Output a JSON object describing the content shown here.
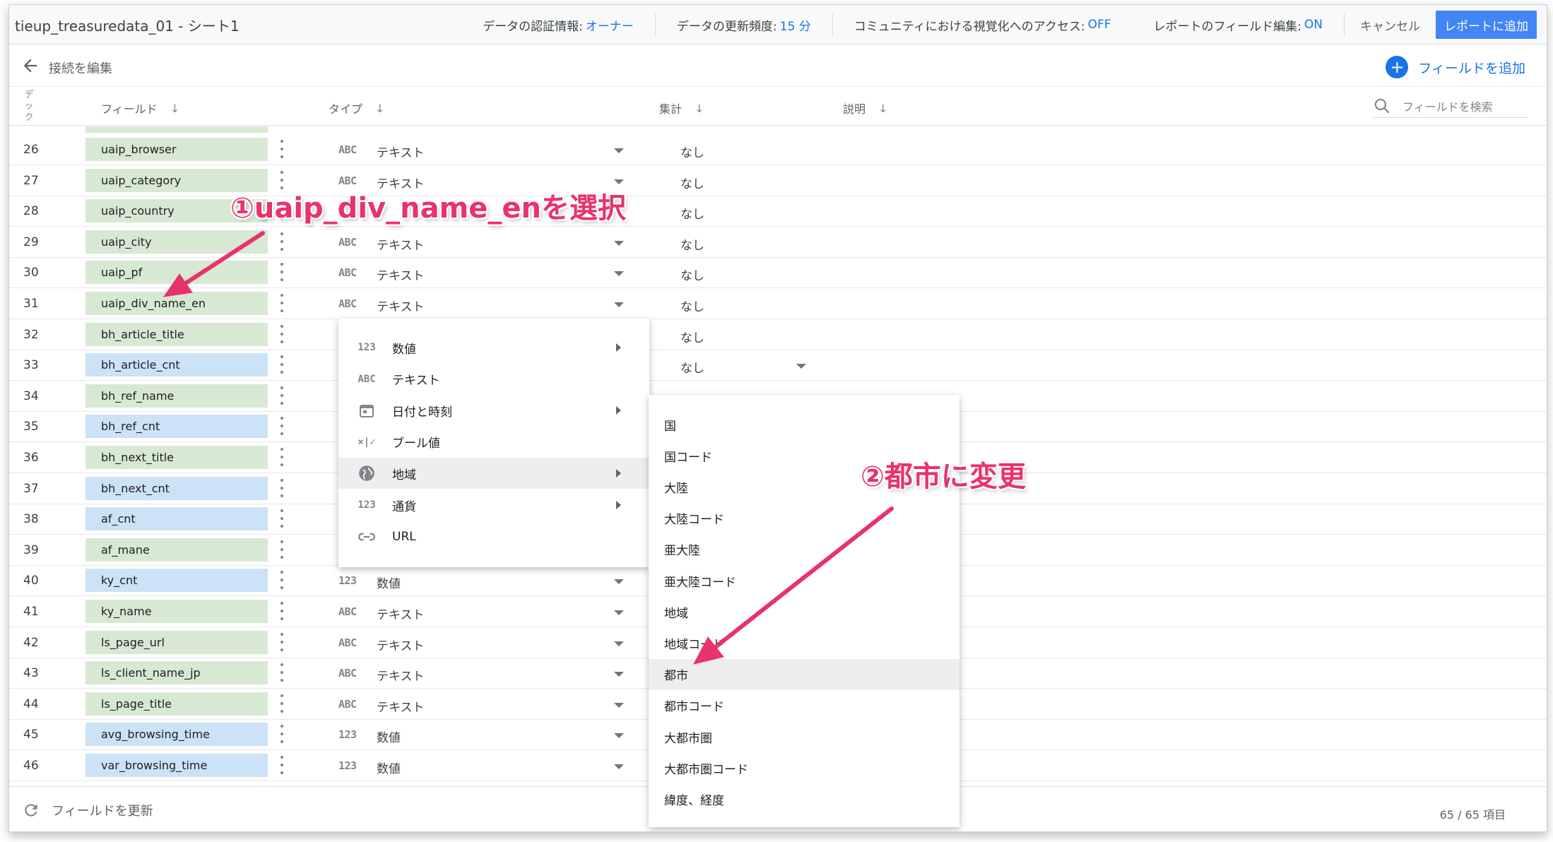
{
  "topbar": {
    "title": "tieup_treasuredata_01 - シート1",
    "credentials_label": "データの認証情報:",
    "credentials_value": "オーナー",
    "freshness_label": "データの更新頻度:",
    "freshness_value": "15 分",
    "community_label": "コミュニティにおける視覚化へのアクセス:",
    "community_value": "OFF",
    "field_edit_label": "レポートのフィールド編集:",
    "field_edit_value": "ON",
    "cancel": "キャンセル",
    "add_to_report": "レポートに追加"
  },
  "subbar": {
    "edit_connection": "接続を編集",
    "add_field": "フィールドを追加"
  },
  "columns": {
    "index": "デ\nッ\nク",
    "field": "フィールド",
    "type": "タイプ",
    "aggregation": "集計",
    "description": "説明",
    "search_placeholder": "フィールドを検索"
  },
  "rows": [
    {
      "n": "26",
      "name": "uaip_browser",
      "kind": "dim",
      "icon": "ABC",
      "type": "テキスト",
      "agg": "なし"
    },
    {
      "n": "27",
      "name": "uaip_category",
      "kind": "dim",
      "icon": "ABC",
      "type": "テキスト",
      "agg": "なし"
    },
    {
      "n": "28",
      "name": "uaip_country",
      "kind": "dim",
      "icon": "",
      "type": "",
      "agg": "なし"
    },
    {
      "n": "29",
      "name": "uaip_city",
      "kind": "dim",
      "icon": "ABC",
      "type": "テキスト",
      "agg": "なし"
    },
    {
      "n": "30",
      "name": "uaip_pf",
      "kind": "dim",
      "icon": "ABC",
      "type": "テキスト",
      "agg": "なし"
    },
    {
      "n": "31",
      "name": "uaip_div_name_en",
      "kind": "dim",
      "icon": "ABC",
      "type": "テキスト",
      "agg": "なし"
    },
    {
      "n": "32",
      "name": "bh_article_title",
      "kind": "dim",
      "icon": "",
      "type": "",
      "agg": "なし"
    },
    {
      "n": "33",
      "name": "bh_article_cnt",
      "kind": "met",
      "icon": "",
      "type": "",
      "agg": "なし"
    },
    {
      "n": "34",
      "name": "bh_ref_name",
      "kind": "dim",
      "icon": "",
      "type": "",
      "agg": ""
    },
    {
      "n": "35",
      "name": "bh_ref_cnt",
      "kind": "met",
      "icon": "",
      "type": "",
      "agg": ""
    },
    {
      "n": "36",
      "name": "bh_next_title",
      "kind": "dim",
      "icon": "",
      "type": "",
      "agg": ""
    },
    {
      "n": "37",
      "name": "bh_next_cnt",
      "kind": "met",
      "icon": "",
      "type": "",
      "agg": ""
    },
    {
      "n": "38",
      "name": "af_cnt",
      "kind": "met",
      "icon": "",
      "type": "",
      "agg": ""
    },
    {
      "n": "39",
      "name": "af_mane",
      "kind": "dim",
      "icon": "",
      "type": "",
      "agg": ""
    },
    {
      "n": "40",
      "name": "ky_cnt",
      "kind": "met",
      "icon": "123",
      "type": "数値",
      "agg": ""
    },
    {
      "n": "41",
      "name": "ky_name",
      "kind": "dim",
      "icon": "ABC",
      "type": "テキスト",
      "agg": ""
    },
    {
      "n": "42",
      "name": "ls_page_url",
      "kind": "dim",
      "icon": "ABC",
      "type": "テキスト",
      "agg": ""
    },
    {
      "n": "43",
      "name": "ls_client_name_jp",
      "kind": "dim",
      "icon": "ABC",
      "type": "テキスト",
      "agg": ""
    },
    {
      "n": "44",
      "name": "ls_page_title",
      "kind": "dim",
      "icon": "ABC",
      "type": "テキスト",
      "agg": ""
    },
    {
      "n": "45",
      "name": "avg_browsing_time",
      "kind": "met",
      "icon": "123",
      "type": "数値",
      "agg": ""
    },
    {
      "n": "46",
      "name": "var_browsing_time",
      "kind": "met",
      "icon": "123",
      "type": "数値",
      "agg": ""
    }
  ],
  "type_menu": [
    {
      "icon": "123",
      "label": "数値",
      "submenu": true
    },
    {
      "icon": "ABC",
      "label": "テキスト",
      "submenu": false
    },
    {
      "icon": "calendar-icon",
      "label": "日付と時刻",
      "submenu": true
    },
    {
      "icon": "×|✓",
      "label": "ブール値",
      "submenu": false
    },
    {
      "icon": "globe-icon",
      "label": "地域",
      "submenu": true
    },
    {
      "icon": "123",
      "label": "通貨",
      "submenu": true
    },
    {
      "icon": "link-icon",
      "label": "URL",
      "submenu": false
    }
  ],
  "geo_menu": [
    "国",
    "国コード",
    "大陸",
    "大陸コード",
    "亜大陸",
    "亜大陸コード",
    "地域",
    "地域コード",
    "都市",
    "都市コード",
    "大都市圏",
    "大都市圏コード",
    "緯度、経度"
  ],
  "footer": {
    "refresh": "フィールドを更新",
    "count": "65 / 65 項目"
  },
  "annotations": {
    "step1": "①uaip_div_name_enを選択",
    "step2": "②都市に変更"
  },
  "colors": {
    "accent": "#1a73e8",
    "dimension_chip": "#d7e9d2",
    "metric_chip": "#cbe2f7",
    "annotation": "#e8336b"
  }
}
